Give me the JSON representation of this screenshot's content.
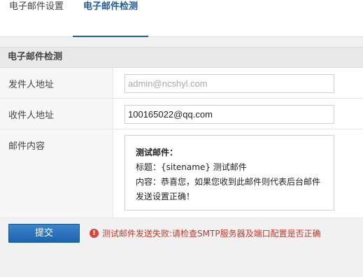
{
  "tabs": [
    {
      "label": "电子邮件设置",
      "active": false
    },
    {
      "label": "电子邮件检测",
      "active": true
    }
  ],
  "section": {
    "title": "电子邮件检测"
  },
  "form": {
    "sender": {
      "label": "发件人地址",
      "value": "",
      "placeholder": "admin@ncshyl.com"
    },
    "recipient": {
      "label": "收件人地址",
      "value": "100165022@qq.com"
    },
    "content": {
      "label": "邮件内容",
      "title_line": "测试邮件：",
      "subject_line": "标题：{sitename} 测试邮件",
      "body_line1": "内容：恭喜您，如果您收到此邮件则代表后台邮件",
      "body_line2": "发送设置正确！"
    }
  },
  "actions": {
    "submit_label": "提交"
  },
  "status": {
    "icon": "exclamation-icon",
    "message": "测试邮件发送失败:请检查SMTP服务器及端口配置是否正确",
    "color": "#c0392b"
  },
  "colors": {
    "accent": "#1f5a94",
    "button": "#2b74bf"
  }
}
